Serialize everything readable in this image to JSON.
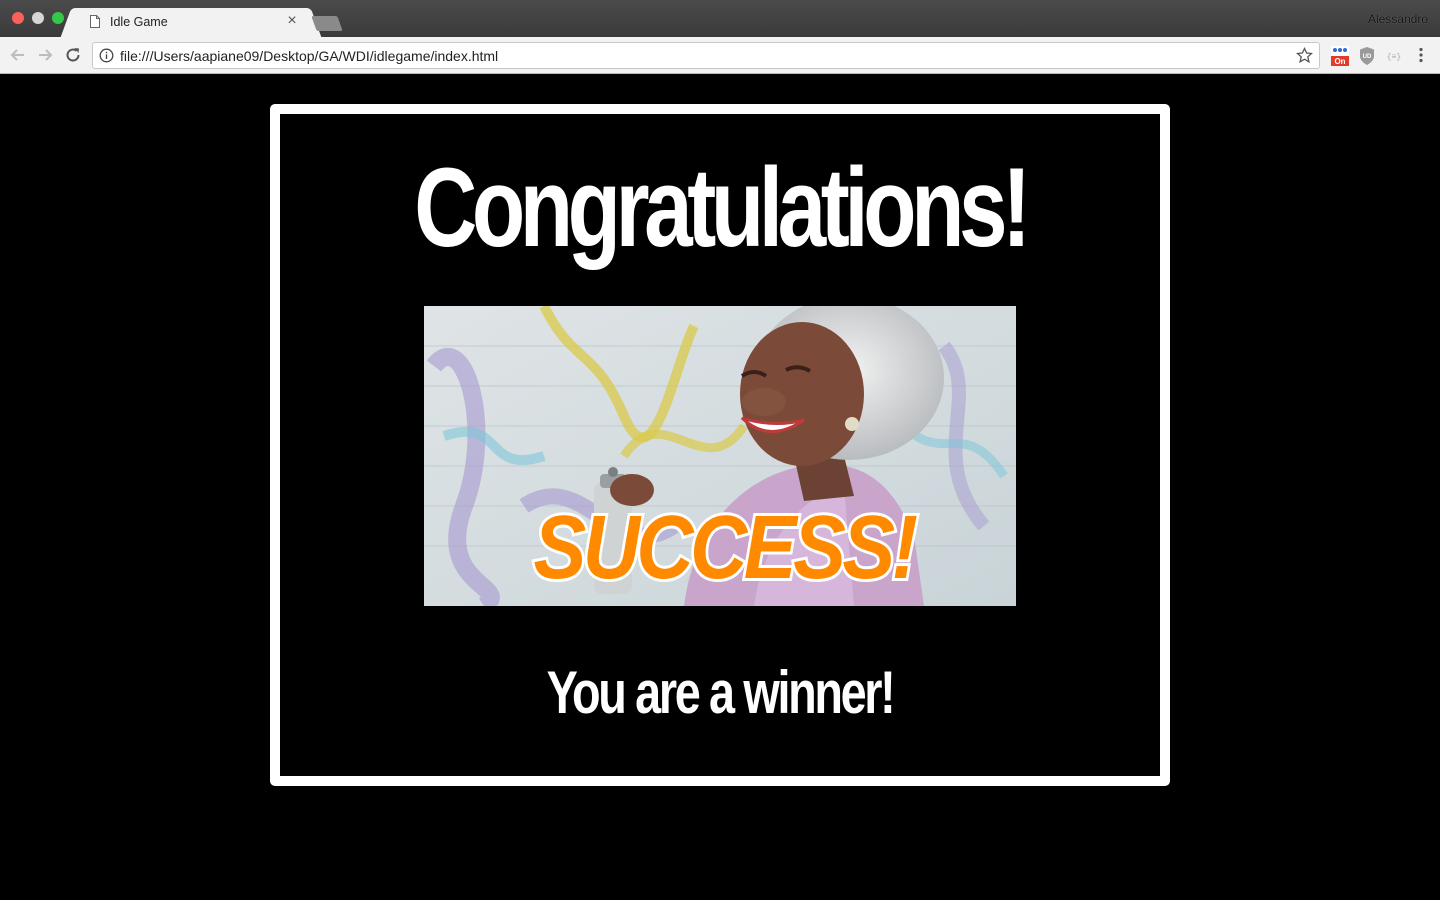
{
  "browser": {
    "tab": {
      "title": "Idle Game"
    },
    "profile_name": "Alessandro",
    "address_bar": {
      "url": "file:///Users/aapiane09/Desktop/GA/WDI/idlegame/index.html"
    },
    "extensions": [
      {
        "name": "tampermonkey-icon",
        "badge": "On"
      },
      {
        "name": "ublock-shield-icon"
      },
      {
        "name": "json-viewer-icon"
      }
    ]
  },
  "page": {
    "headline": "Congratulations!",
    "image_caption": "SUCCESS!",
    "subline": "You are a winner!"
  },
  "colors": {
    "page_background": "#000000",
    "panel_border": "#ffffff",
    "success_text": "#ff8a00"
  }
}
